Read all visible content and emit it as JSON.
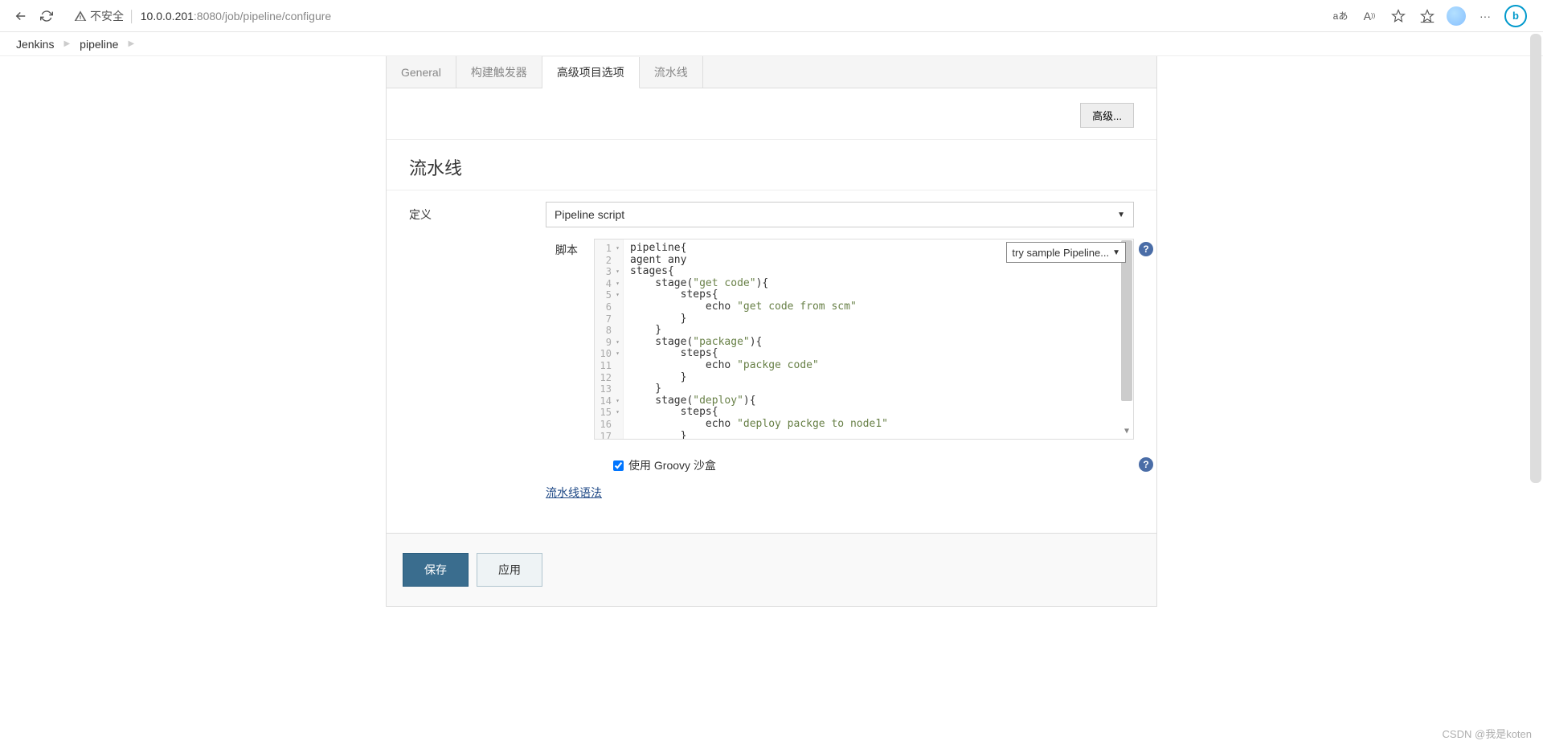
{
  "browser": {
    "security_label": "不安全",
    "host": "10.0.0.201",
    "port": ":8080",
    "path": "/job/pipeline/configure",
    "lang_badge": "aあ"
  },
  "breadcrumb": {
    "items": [
      "Jenkins",
      "pipeline"
    ]
  },
  "tabs": {
    "items": [
      {
        "label": "General"
      },
      {
        "label": "构建触发器"
      },
      {
        "label": "高级项目选项",
        "active": true
      },
      {
        "label": "流水线"
      }
    ]
  },
  "advanced_btn": "高级...",
  "section": {
    "title": "流水线",
    "definition_label": "定义",
    "definition_value": "Pipeline script",
    "script_label": "脚本",
    "sample_label": "try sample Pipeline..."
  },
  "editor": {
    "lines": [
      {
        "n": 1,
        "fold": true,
        "html": "pipeline{"
      },
      {
        "n": 2,
        "fold": false,
        "html": "agent any"
      },
      {
        "n": 3,
        "fold": true,
        "html": "stages{"
      },
      {
        "n": 4,
        "fold": true,
        "html": "    stage(<span class='tok-str'>\"get code\"</span>){"
      },
      {
        "n": 5,
        "fold": true,
        "html": "        steps{"
      },
      {
        "n": 6,
        "fold": false,
        "html": "            echo <span class='tok-str'>\"get code from scm\"</span>"
      },
      {
        "n": 7,
        "fold": false,
        "html": "        }"
      },
      {
        "n": 8,
        "fold": false,
        "html": "    }"
      },
      {
        "n": 9,
        "fold": true,
        "html": "    stage(<span class='tok-str'>\"package\"</span>){"
      },
      {
        "n": 10,
        "fold": true,
        "html": "        steps{"
      },
      {
        "n": 11,
        "fold": false,
        "html": "            echo <span class='tok-str'>\"packge code\"</span>"
      },
      {
        "n": 12,
        "fold": false,
        "html": "        }"
      },
      {
        "n": 13,
        "fold": false,
        "html": "    }"
      },
      {
        "n": 14,
        "fold": true,
        "html": "    stage(<span class='tok-str'>\"deploy\"</span>){"
      },
      {
        "n": 15,
        "fold": true,
        "html": "        steps{"
      },
      {
        "n": 16,
        "fold": false,
        "html": "            echo <span class='tok-str'>\"deploy packge to node1\"</span>"
      },
      {
        "n": 17,
        "fold": false,
        "html": "        }"
      }
    ]
  },
  "sandbox": {
    "label": "使用 Groovy 沙盒",
    "checked": true
  },
  "syntax_link": "流水线语法",
  "buttons": {
    "save": "保存",
    "apply": "应用"
  },
  "watermark": "CSDN @我是koten"
}
